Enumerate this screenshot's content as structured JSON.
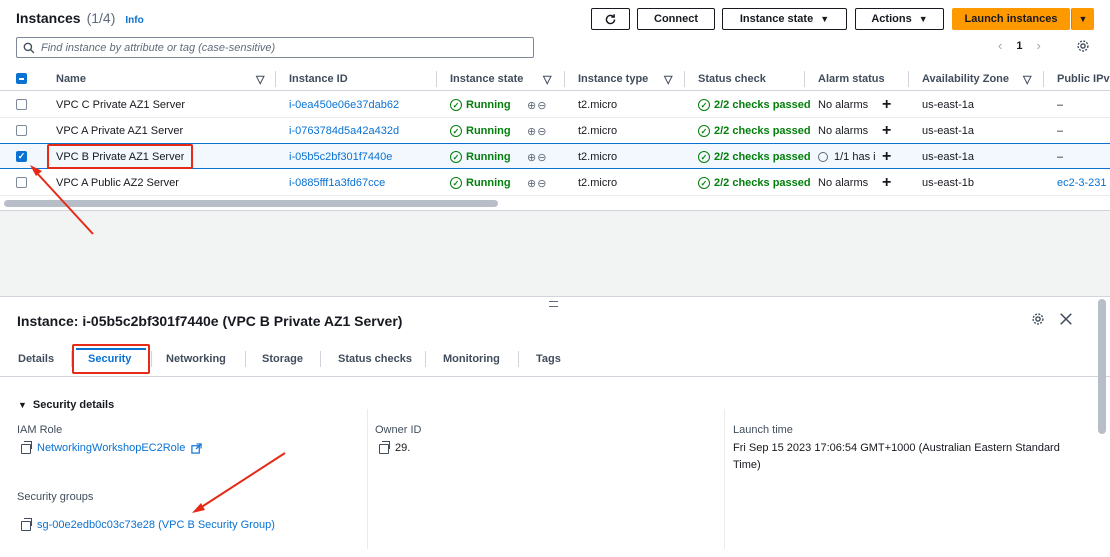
{
  "header": {
    "title": "Instances",
    "count": "(1/4)",
    "info": "Info"
  },
  "toolbar": {
    "refresh_icon": "refresh-icon",
    "connect": "Connect",
    "instance_state": "Instance state",
    "actions": "Actions",
    "launch": "Launch instances",
    "caret": "▼"
  },
  "search": {
    "placeholder": "Find instance by attribute or tag (case-sensitive)"
  },
  "pagination": {
    "page": "1",
    "prev": "‹",
    "next": "›"
  },
  "table": {
    "columns": [
      "Name",
      "Instance ID",
      "Instance state",
      "Instance type",
      "Status check",
      "Alarm status",
      "Availability Zone",
      "Public IPv"
    ],
    "rows": [
      {
        "name": "VPC C Private AZ1 Server",
        "id": "i-0ea450e06e37dab62",
        "state": "Running",
        "type": "t2.micro",
        "status": "2/2 checks passed",
        "alarm": "No alarms",
        "az": "us-east-1a",
        "ip": "–",
        "selected": false
      },
      {
        "name": "VPC A Private AZ1 Server",
        "id": "i-0763784d5a42a432d",
        "state": "Running",
        "type": "t2.micro",
        "status": "2/2 checks passed",
        "alarm": "No alarms",
        "az": "us-east-1a",
        "ip": "–",
        "selected": false
      },
      {
        "name": "VPC B Private AZ1 Server",
        "id": "i-05b5c2bf301f7440e",
        "state": "Running",
        "type": "t2.micro",
        "status": "2/2 checks passed",
        "alarm": "1/1 has i",
        "az": "us-east-1a",
        "ip": "–",
        "selected": true
      },
      {
        "name": "VPC A Public AZ2 Server",
        "id": "i-0885fff1a3fd67cce",
        "state": "Running",
        "type": "t2.micro",
        "status": "2/2 checks passed",
        "alarm": "No alarms",
        "az": "us-east-1b",
        "ip": "ec2-3-231",
        "selected": false
      }
    ]
  },
  "detail": {
    "title": "Instance: i-05b5c2bf301f7440e (VPC B Private AZ1 Server)",
    "tabs": [
      "Details",
      "Security",
      "Networking",
      "Storage",
      "Status checks",
      "Monitoring",
      "Tags"
    ],
    "active_tab": "Security",
    "section": "Security details",
    "iam_role_label": "IAM Role",
    "iam_role_value": "NetworkingWorkshopEC2Role",
    "owner_label": "Owner ID",
    "owner_value": "29.",
    "launch_label": "Launch time",
    "launch_value": "Fri Sep 15 2023 17:06:54 GMT+1000 (Australian Eastern Standard Time)",
    "sg_label": "Security groups",
    "sg_value": "sg-00e2edb0c03c73e28 (VPC B Security Group)"
  },
  "colors": {
    "accent": "#0972d3",
    "launch": "#ff9900",
    "success": "#037f0c",
    "annotation": "#e52a17"
  }
}
